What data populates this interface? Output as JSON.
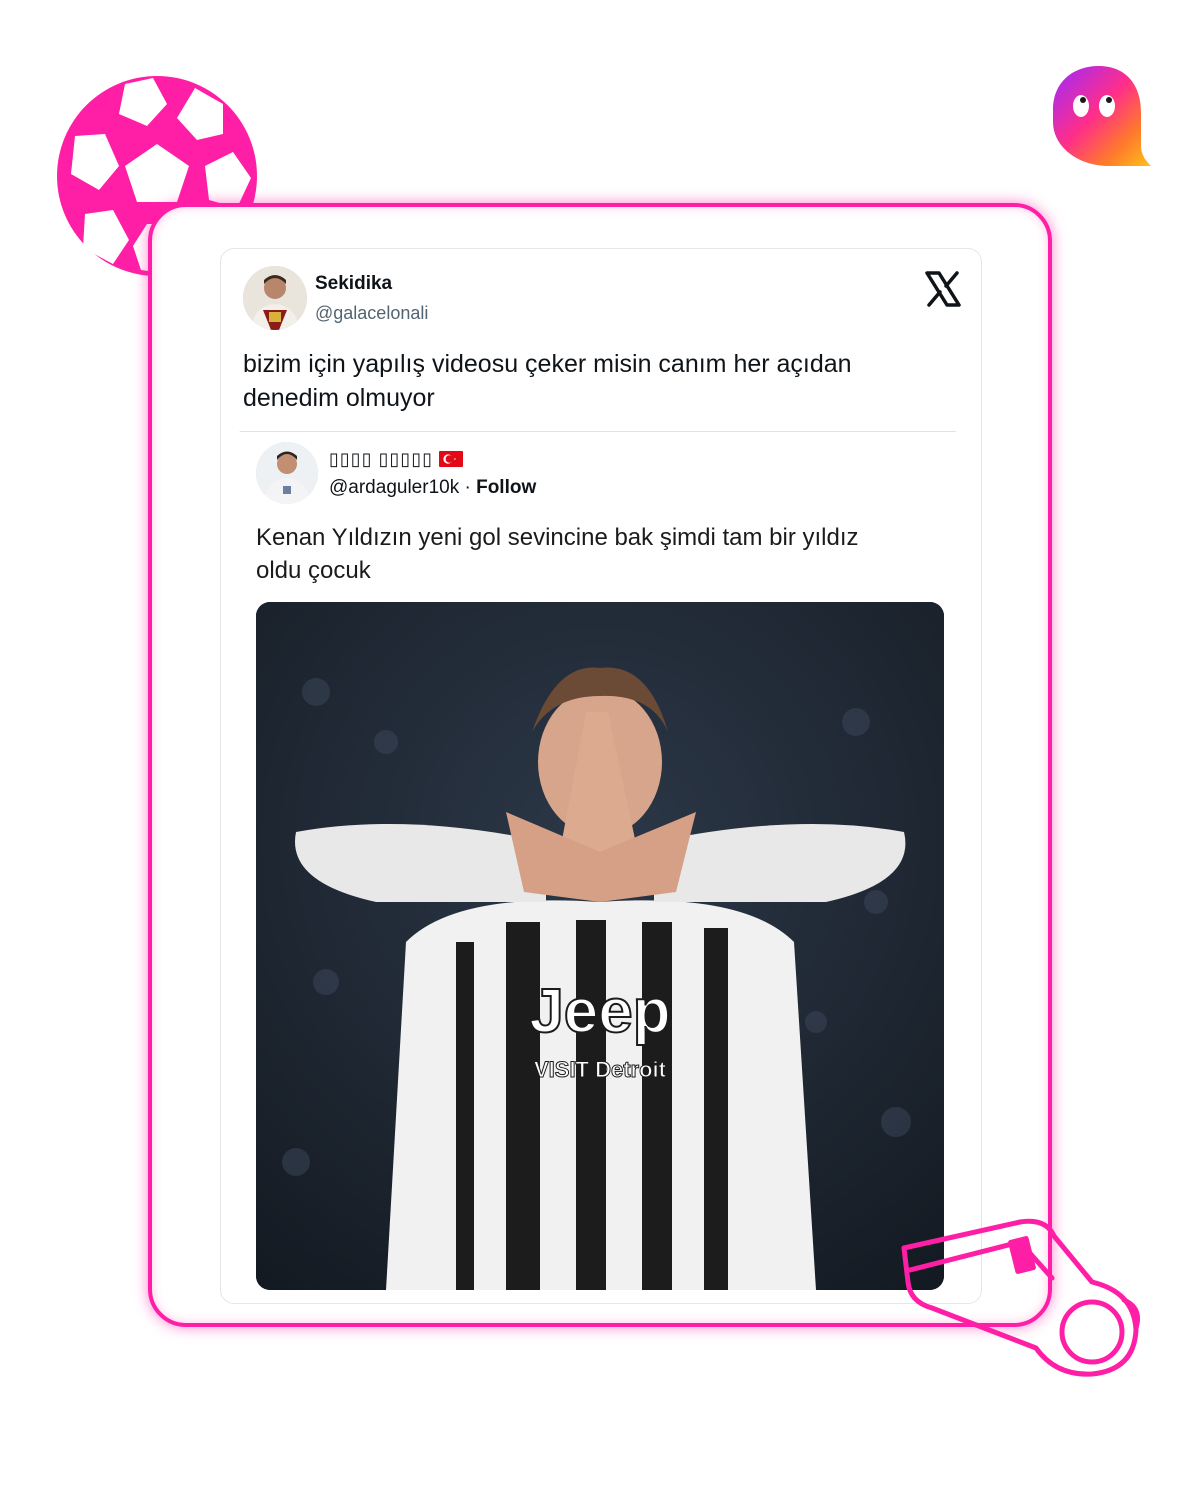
{
  "tweet": {
    "author_name": "Sekidika",
    "author_handle": "@galacelonali",
    "text": "bizim için yapılış videosu çeker misin canım her açıdan denedim olmuyor",
    "platform_icon": "x-logo-icon"
  },
  "quoted_tweet": {
    "author_name": "▯▯▯▯ ▯▯▯▯▯",
    "author_handle": "@ardaguler10k",
    "separator": " · ",
    "follow_label": "Follow",
    "text": "Kenan Yıldızın yeni gol sevincine bak şimdi tam bir yıldız oldu çocuk",
    "flag_icon": "turkey-flag-icon",
    "media": {
      "sponsor_text": "Jeep",
      "sponsor_subtext": "VISIT Detroit"
    }
  },
  "decorations": {
    "accent_color": "#ff1fa6",
    "ball_icon": "soccer-ball-icon",
    "whistle_icon": "whistle-icon",
    "brand_icon": "ghost-logo-icon"
  }
}
